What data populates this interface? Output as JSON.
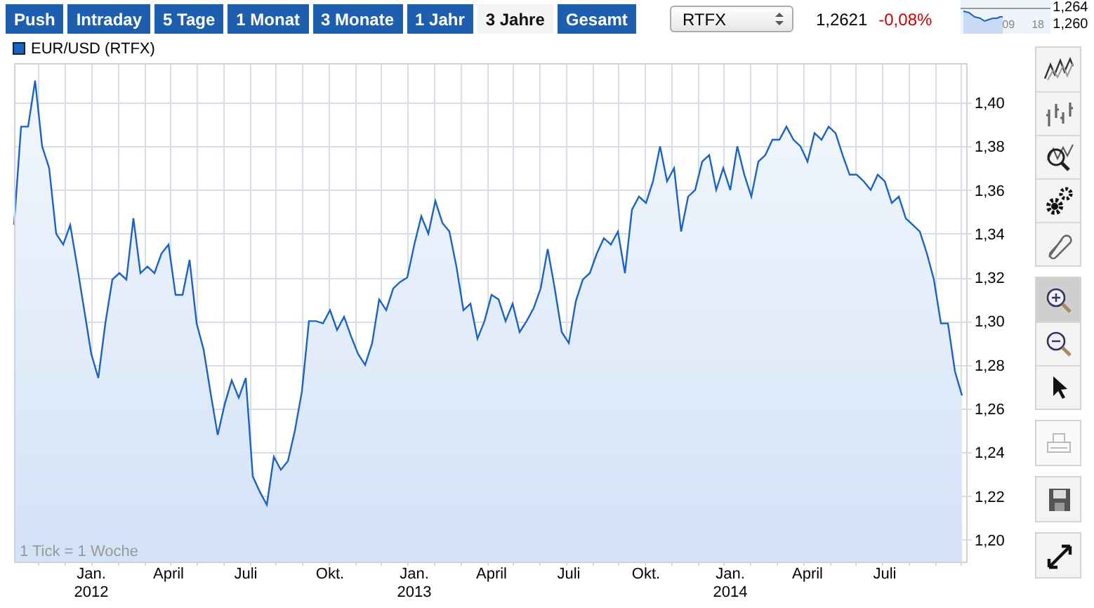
{
  "range_tabs": [
    {
      "label": "Push",
      "selected": false
    },
    {
      "label": "Intraday",
      "selected": false
    },
    {
      "label": "5 Tage",
      "selected": false
    },
    {
      "label": "1 Monat",
      "selected": false
    },
    {
      "label": "3 Monate",
      "selected": false
    },
    {
      "label": "1 Jahr",
      "selected": false
    },
    {
      "label": "3 Jahre",
      "selected": true
    },
    {
      "label": "Gesamt",
      "selected": false
    }
  ],
  "exchange_select": {
    "value": "RTFX"
  },
  "quote": {
    "price": "1,2621",
    "change": "-0,08%"
  },
  "mini_chart": {
    "y_labels": [
      "1,264",
      "1,260"
    ],
    "x_labels": [
      "09",
      "18"
    ]
  },
  "chart": {
    "note": "1 Tick = 1 Woche",
    "chart_data": {
      "type": "area",
      "grid": true,
      "ylim": [
        1.19,
        1.418
      ],
      "categories": [
        null,
        null,
        null,
        null,
        null,
        null,
        null,
        null,
        null,
        null,
        null,
        "Jan. 2012",
        null,
        null,
        null,
        null,
        null,
        null,
        null,
        null,
        null,
        null,
        "April",
        null,
        null,
        null,
        null,
        null,
        null,
        null,
        null,
        null,
        null,
        "Juli",
        null,
        null,
        null,
        null,
        null,
        null,
        null,
        null,
        null,
        null,
        null,
        "Okt.",
        null,
        null,
        null,
        null,
        null,
        null,
        null,
        null,
        null,
        null,
        null,
        "Jan. 2013",
        null,
        null,
        null,
        null,
        null,
        null,
        null,
        null,
        null,
        null,
        "April",
        null,
        null,
        null,
        null,
        null,
        null,
        null,
        null,
        null,
        null,
        "Juli",
        null,
        null,
        null,
        null,
        null,
        null,
        null,
        null,
        null,
        null,
        "Okt.",
        null,
        null,
        null,
        null,
        null,
        null,
        null,
        null,
        null,
        null,
        null,
        "Jan. 2014",
        null,
        null,
        null,
        null,
        null,
        null,
        null,
        null,
        null,
        null,
        "April",
        null,
        null,
        null,
        null,
        null,
        null,
        null,
        null,
        null,
        null,
        "Juli",
        null,
        null,
        null,
        null,
        null,
        null,
        null,
        null,
        null,
        null,
        null
      ],
      "yticks": [
        {
          "value": 1.2,
          "label": "1,20"
        },
        {
          "value": 1.22,
          "label": "1,22"
        },
        {
          "value": 1.24,
          "label": "1,24"
        },
        {
          "value": 1.26,
          "label": "1,26"
        },
        {
          "value": 1.28,
          "label": "1,28"
        },
        {
          "value": 1.3,
          "label": "1,30"
        },
        {
          "value": 1.32,
          "label": "1,32"
        },
        {
          "value": 1.34,
          "label": "1,34"
        },
        {
          "value": 1.36,
          "label": "1,36"
        },
        {
          "value": 1.38,
          "label": "1,38"
        },
        {
          "value": 1.4,
          "label": "1,40"
        }
      ],
      "series": [
        {
          "name": "EUR/USD (RTFX)",
          "color": "#1a63c4",
          "values": [
            1.344,
            1.389,
            1.389,
            1.41,
            1.38,
            1.37,
            1.34,
            1.335,
            1.344,
            1.325,
            1.305,
            1.285,
            1.274,
            1.299,
            1.319,
            1.322,
            1.319,
            1.347,
            1.322,
            1.325,
            1.322,
            1.331,
            1.335,
            1.312,
            1.312,
            1.328,
            1.299,
            1.287,
            1.267,
            1.248,
            1.262,
            1.273,
            1.265,
            1.274,
            1.229,
            1.222,
            1.216,
            1.238,
            1.232,
            1.236,
            1.25,
            1.268,
            1.3,
            1.3,
            1.299,
            1.305,
            1.296,
            1.302,
            1.293,
            1.285,
            1.28,
            1.29,
            1.31,
            1.305,
            1.315,
            1.318,
            1.32,
            1.335,
            1.348,
            1.34,
            1.355,
            1.345,
            1.341,
            1.325,
            1.305,
            1.308,
            1.292,
            1.3,
            1.312,
            1.31,
            1.3,
            1.308,
            1.295,
            1.3,
            1.306,
            1.315,
            1.333,
            1.315,
            1.295,
            1.29,
            1.309,
            1.319,
            1.322,
            1.331,
            1.338,
            1.335,
            1.341,
            1.322,
            1.351,
            1.357,
            1.354,
            1.364,
            1.38,
            1.364,
            1.37,
            1.341,
            1.357,
            1.36,
            1.373,
            1.376,
            1.36,
            1.37,
            1.36,
            1.38,
            1.367,
            1.357,
            1.373,
            1.376,
            1.383,
            1.383,
            1.389,
            1.383,
            1.38,
            1.373,
            1.386,
            1.383,
            1.389,
            1.386,
            1.376,
            1.367,
            1.367,
            1.364,
            1.36,
            1.367,
            1.364,
            1.354,
            1.357,
            1.347,
            1.344,
            1.341,
            1.331,
            1.319,
            1.299,
            1.299,
            1.277,
            1.266
          ]
        }
      ]
    }
  },
  "toolbar": {
    "groups": [
      [
        {
          "kind": "line",
          "selected": false,
          "disabled": false
        },
        {
          "kind": "ohlc",
          "selected": false,
          "disabled": false
        },
        {
          "kind": "zoom-chart",
          "selected": false,
          "disabled": false
        },
        {
          "kind": "settings",
          "selected": false,
          "disabled": false
        },
        {
          "kind": "link",
          "selected": false,
          "disabled": false
        }
      ],
      [
        {
          "kind": "zoom-in",
          "selected": true,
          "disabled": false
        },
        {
          "kind": "zoom-out",
          "selected": false,
          "disabled": false
        },
        {
          "kind": "pointer",
          "selected": false,
          "disabled": false
        }
      ],
      [
        {
          "kind": "print",
          "selected": false,
          "disabled": true
        }
      ],
      [
        {
          "kind": "save",
          "selected": false,
          "disabled": false
        }
      ],
      [
        {
          "kind": "fullscreen",
          "selected": false,
          "disabled": false
        }
      ]
    ]
  }
}
